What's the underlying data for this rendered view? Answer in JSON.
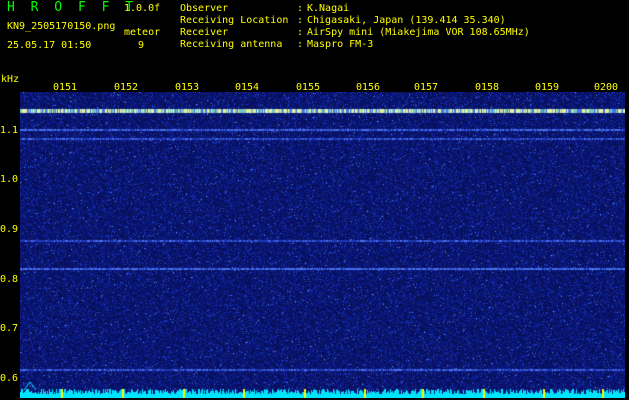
{
  "header": {
    "brand": "HROFFT",
    "version": "1.0.0f",
    "filename": "KN9_2505170150.png",
    "timestamp": "25.05.17 01:50",
    "meteor_label": "meteor",
    "meteor_count": "9"
  },
  "info": [
    {
      "label": "Observer",
      "value": "K.Nagai"
    },
    {
      "label": "Receiving Location",
      "value": "Chigasaki, Japan (139.414 35.340)"
    },
    {
      "label": "Receiver",
      "value": "AirSpy mini (Miakejima VOR 108.65MHz)"
    },
    {
      "label": "Receiving antenna",
      "value": "Maspro FM-3"
    }
  ],
  "axis": {
    "unit": "kHz",
    "time_ticks": [
      "0151",
      "0152",
      "0153",
      "0154",
      "0155",
      "0156",
      "0157",
      "0158",
      "0159",
      "0200"
    ],
    "freq_ticks": [
      "1.1",
      "1.0",
      "0.9",
      "0.8",
      "0.7",
      "0.6"
    ]
  },
  "colors": {
    "background": "#000000",
    "text": "#ffff00",
    "brand": "#00ff00",
    "noise_floor": "#0a1a6e",
    "signal_line": "#4f7dff",
    "carrier": "#e6f0a0",
    "ticks": "#ffff00",
    "spectrum": "#00e5ff"
  }
}
